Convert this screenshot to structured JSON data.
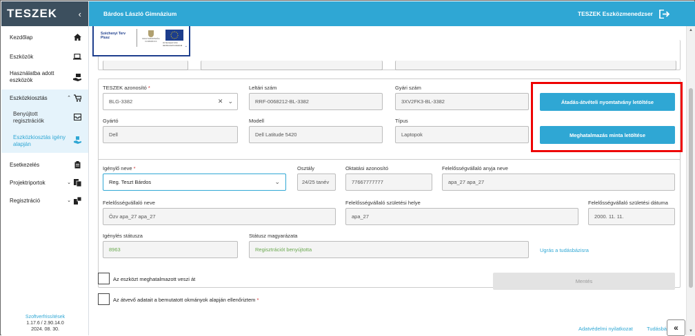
{
  "sidebar": {
    "title": "TESZEK",
    "toggle_icon": "chevron-left-icon",
    "items": [
      {
        "label": "Kezdőlap",
        "icon": "home-icon"
      },
      {
        "label": "Eszközök",
        "icon": "laptop-icon"
      },
      {
        "label": "Használatba adott eszközök",
        "icon": "hand-device-icon"
      },
      {
        "label": "Eszközkiosztás",
        "icon": "cart-icon"
      },
      {
        "label": "Benyújtott regisztrációk",
        "icon": "inbox-icon"
      },
      {
        "label": "Eszközkiosztás igény alapján",
        "icon": "hand-gift-icon"
      },
      {
        "label": "Esetkezelés",
        "icon": "clipboard-icon"
      },
      {
        "label": "Projektriportok",
        "icon": "report-icon"
      },
      {
        "label": "Regisztráció",
        "icon": "registration-icon"
      }
    ],
    "footer": {
      "link": "Szoftverfrissítések",
      "version": "1.17.6 / 2.90.14.0",
      "date": "2024. 08. 30."
    }
  },
  "header": {
    "school": "Bárdos László Gimnázium",
    "app_name": "TESZEK Eszközmenedzser",
    "logout_icon": "logout-icon"
  },
  "logos": {
    "szechenyi": "Széchenyi Terv Plusz",
    "ministry": "MAGYARORSZÁG KORMÁNYA",
    "eu": "Az Európai Unió társfinanszírozásával"
  },
  "device": {
    "teszek_id_label": "TESZEK azonosító",
    "teszek_id_value": "BLG-3382",
    "inventory_label": "Leltári szám",
    "inventory_value": "RRF-0068212-BL-3382",
    "serial_label": "Gyári szám",
    "serial_value": "3XV2FK3-BL-3382",
    "manufacturer_label": "Gyártó",
    "manufacturer_value": "Dell",
    "model_label": "Modell",
    "model_value": "Dell Latitude 5420",
    "type_label": "Típus",
    "type_value": "Laptopok",
    "download_handover_button": "Átadás-átvételi nyomtatvány letöltése",
    "download_authorization_button": "Meghatalmazás minta letöltése"
  },
  "applicant": {
    "name_label": "Igénylő neve",
    "name_value": "Reg. Teszt Bárdos",
    "class_label": "Osztály",
    "class_value": "24/25 tanév",
    "edu_id_label": "Oktatási azonosító",
    "edu_id_value": "77667777777",
    "guardian_mother_label": "Felelősségvállaló anyja neve",
    "guardian_mother_value": "apa_27 apa_27",
    "guardian_name_label": "Felelősségvállaló neve",
    "guardian_name_value": "Özv apa_27 apa_27",
    "guardian_birthplace_label": "Felelősségvállaló születési helye",
    "guardian_birthplace_value": "apa_27",
    "guardian_birthdate_label": "Felelősségvállaló születési dátuma",
    "guardian_birthdate_value": "2000. 11. 11.",
    "status_label": "Igénylés státusza",
    "status_value": "8963",
    "status_desc_label": "Státusz magyarázata",
    "status_desc_value": "Regisztrációt benyújtotta",
    "kb_link": "Ugrás a tudásbázisra"
  },
  "form": {
    "checkbox_authorized": "Az eszközt meghatalmazott veszi át",
    "checkbox_verified": "Az átvevő adatait a bemutatott okmányok alapján ellenőriztem",
    "save_button": "Mentés"
  },
  "bottom": {
    "privacy_link": "Adatvédelmi nyilatkozat",
    "kb_link": "Tudásbá"
  }
}
